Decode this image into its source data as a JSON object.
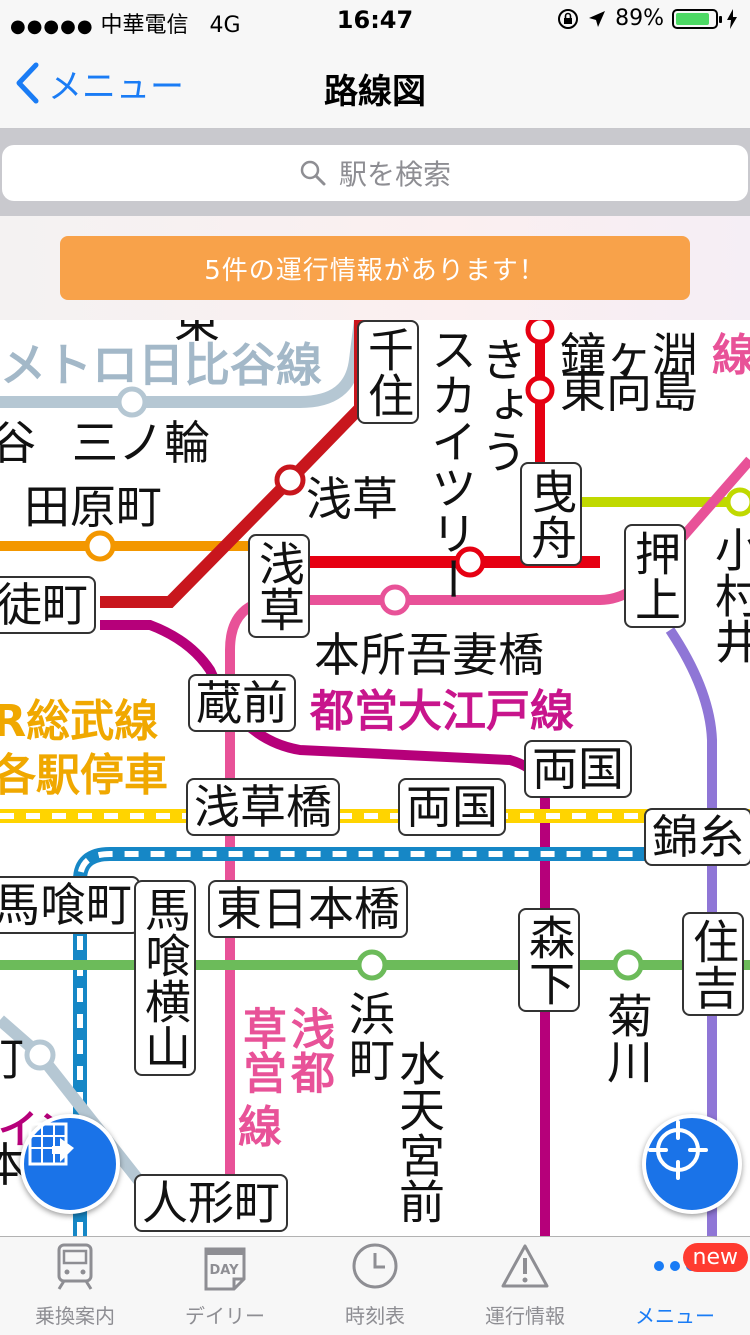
{
  "status_bar": {
    "carrier": "中華電信",
    "network": "4G",
    "time": "16:47",
    "battery_percent": "89%",
    "battery_level": 0.89,
    "battery_color": "#4cd964"
  },
  "nav": {
    "back_label": "メニュー",
    "title": "路線図"
  },
  "search": {
    "placeholder": "駅を検索"
  },
  "alert": {
    "message": "5件の運行情報があります！",
    "color": "#f8a24a"
  },
  "map": {
    "line_labels": {
      "hibiya": "メトロ日比谷線",
      "sobu_1": "JR総武線",
      "sobu_2": "各駅停車",
      "oedo": "都営大江戸線",
      "asakusa_a": "浅都",
      "asakusa_b": "草営",
      "asakusa_c": "線",
      "oshiage_right": "線"
    },
    "stations": {
      "minowa": "三ノ輪",
      "tawaramachi": "田原町",
      "inaricho_frag": "徒町",
      "asakusa": "浅草",
      "asakusa_box": "浅草",
      "senju": "千住",
      "skytree": "スカイツリー",
      "hikifune_kyo": "きょう",
      "higashimukojima": "東向島",
      "hikifune": "曳舟",
      "oshiage": "押上",
      "komurai": "小村井",
      "honjo_azumabashi": "本所吾妻橋",
      "kuramae": "蔵前",
      "asakusabashi": "浅草橋",
      "ryogoku_1": "両国",
      "ryogoku_2": "両国",
      "kinshicho": "錦糸",
      "bakuro_frag": "馬喰町",
      "bakuro_yokoyama": "馬喰横山",
      "higashi_nihombashi": "東日本橋",
      "hamacho": "浜町",
      "morishita": "森下",
      "kikukawa": "菊川",
      "sumiyoshi": "住吉",
      "suitengumae": "水天宮前",
      "ningyocho": "人形町",
      "tani_frag": "谷",
      "left_frag_1": "町",
      "left_frag_2": "イン",
      "left_frag_3": "本",
      "top_frag_1": "東",
      "top_frag_2": "鐘ヶ淵"
    },
    "colors": {
      "hibiya": "#b5c7d3",
      "ginza": "#f39700",
      "asakusa": "#e85298",
      "tobu": "#e60012",
      "oedo": "#b6007a",
      "sobu_local": "#ffd400",
      "shinjuku": "#6cbb5a",
      "hanzomon": "#8f76d6",
      "tozai": "#009bbf",
      "jr_sobu_text": "#f0a800",
      "oedo_text": "#c8158c",
      "hibiya_text": "#a3b8c8",
      "skytree_line": "#c0d900"
    }
  },
  "fabs": {
    "left_icon": "route-map-icon",
    "right_icon": "locate-icon"
  },
  "tabs": [
    {
      "label": "乗換案内",
      "icon": "train-icon"
    },
    {
      "label": "デイリー",
      "icon": "day-calendar-icon",
      "icon_text": "DAY"
    },
    {
      "label": "時刻表",
      "icon": "clock-icon"
    },
    {
      "label": "運行情報",
      "icon": "warning-icon"
    },
    {
      "label": "メニュー",
      "icon": "more-icon",
      "badge": "new",
      "active": true
    }
  ]
}
